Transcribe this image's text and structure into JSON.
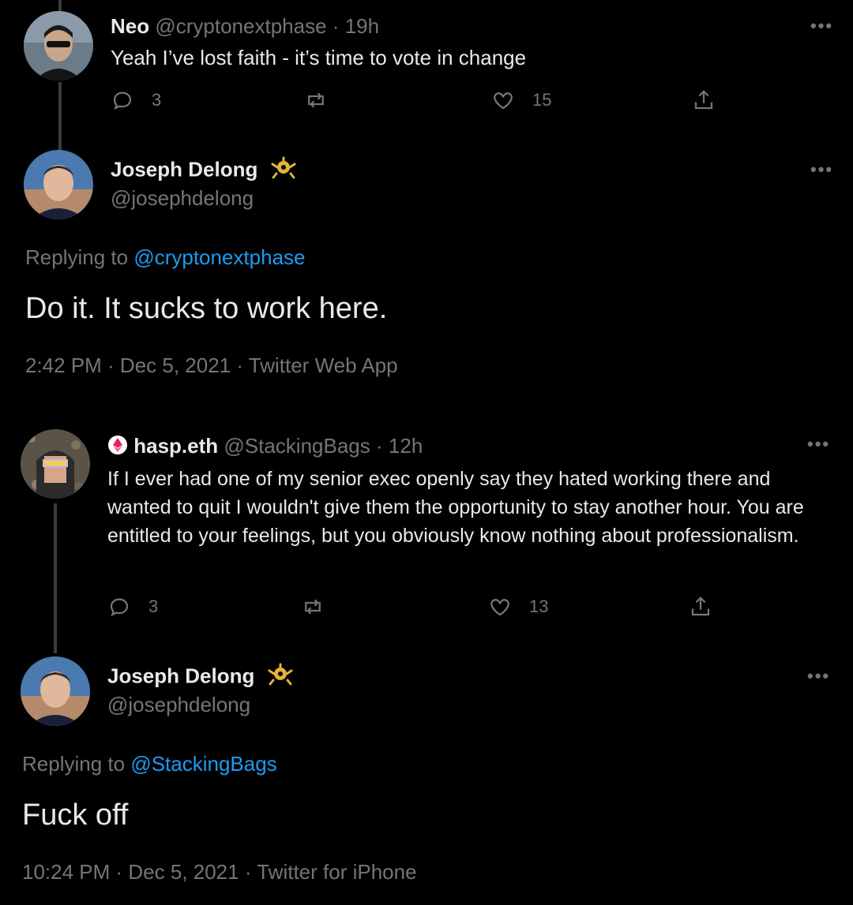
{
  "tweet1": {
    "name": "Neo",
    "handle": "@cryptonextphase",
    "sep": "·",
    "time": "19h",
    "text": "Yeah I’ve lost faith - it’s time to vote in change",
    "replies": "3",
    "likes": "15"
  },
  "tweet2": {
    "name": "Joseph Delong",
    "handle": "@josephdelong",
    "replying_prefix": "Replying to",
    "replying_to": "@cryptonextphase",
    "text": "Do it. It sucks to work here.",
    "meta": "2:42 PM · Dec 5, 2021 · Twitter Web App"
  },
  "tweet3": {
    "name": "hasp.eth",
    "handle": "@StackingBags",
    "sep": "·",
    "time": "12h",
    "text": "If I ever had one of my senior exec openly say they hated working there and wanted to quit I wouldn't give them the opportunity to stay another hour. You  are entitled to your feelings, but you obviously know nothing about professionalism.",
    "replies": "3",
    "likes": "13"
  },
  "tweet4": {
    "name": "Joseph Delong",
    "handle": "@josephdelong",
    "replying_prefix": "Replying to",
    "replying_to": "@StackingBags",
    "text": "Fuck off",
    "meta": "10:24 PM · Dec 5, 2021 · Twitter for iPhone"
  },
  "more_label": "•••",
  "icons": {
    "reply": "reply-icon",
    "retweet": "retweet-icon",
    "like": "heart-icon",
    "share": "share-icon",
    "badge": "gold-badge-icon",
    "nft": "ethereum-pink-icon"
  },
  "colors": {
    "background": "#000000",
    "link": "#1d9bf0",
    "muted": "#71767b",
    "badge": "#e2b33b"
  }
}
